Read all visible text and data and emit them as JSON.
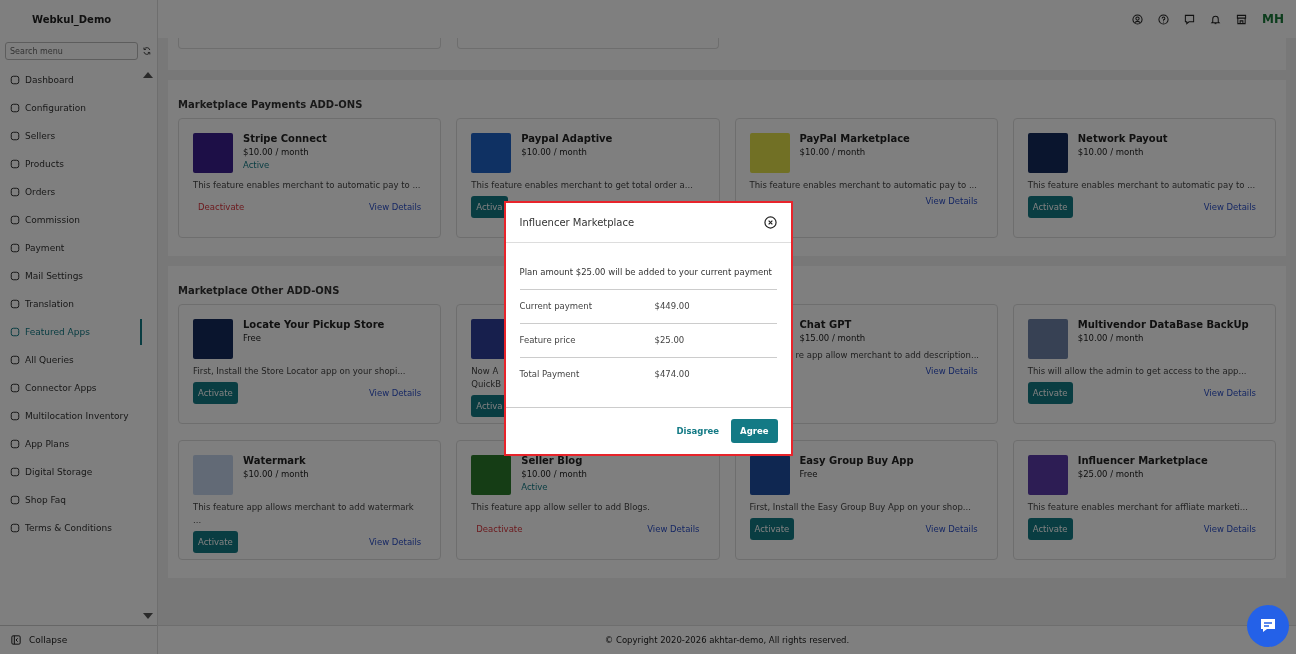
{
  "sidebar": {
    "brand": "Webkul_Demo",
    "search": {
      "placeholder": "Search menu"
    },
    "items": [
      {
        "label": "Dashboard",
        "selected": false
      },
      {
        "label": "Configuration",
        "selected": false
      },
      {
        "label": "Sellers",
        "selected": false
      },
      {
        "label": "Products",
        "selected": false
      },
      {
        "label": "Orders",
        "selected": false
      },
      {
        "label": "Commission",
        "selected": false
      },
      {
        "label": "Payment",
        "selected": false
      },
      {
        "label": "Mail Settings",
        "selected": false
      },
      {
        "label": "Translation",
        "selected": false
      },
      {
        "label": "Featured Apps",
        "selected": true
      },
      {
        "label": "All Queries",
        "selected": false
      },
      {
        "label": "Connector Apps",
        "selected": false
      },
      {
        "label": "Multilocation Inventory",
        "selected": false
      },
      {
        "label": "App Plans",
        "selected": false
      },
      {
        "label": "Digital Storage",
        "selected": false
      },
      {
        "label": "Shop Faq",
        "selected": false
      },
      {
        "label": "Terms & Conditions",
        "selected": false
      }
    ],
    "collapse": "Collapse"
  },
  "topbar": {
    "avatar": "MH"
  },
  "sections": [
    {
      "title": "Marketplace Payments ADD-ONS",
      "cards": [
        {
          "name": "Stripe Connect",
          "price": "$10.00 / month",
          "status": "Active",
          "description": "This feature enables merchant to automatic pay to ...",
          "action": {
            "label": "Deactivate",
            "kind": "deactivate"
          },
          "link": "View Details"
        },
        {
          "name": "Paypal Adaptive",
          "price": "$10.00 / month",
          "description": "This feature enables merchant to get total order a...",
          "action": {
            "label": "Activa",
            "kind": "activate"
          }
        },
        {
          "name": "PayPal Marketplace",
          "price": "$10.00 / month",
          "description": "This feature enables merchant to automatic pay to ...",
          "link": "View Details"
        },
        {
          "name": "Network Payout",
          "price": "$10.00 / month",
          "description": "This feature enables merchant to automatic pay to ...",
          "action": {
            "label": "Activate",
            "kind": "activate"
          },
          "link": "View Details"
        }
      ]
    },
    {
      "title": "Marketplace Other ADD-ONS",
      "cards": [
        {
          "name": "Locate Your Pickup Store",
          "price": "Free",
          "description": "First, Install the Store Locator app on your shopi...",
          "action": {
            "label": "Activate",
            "kind": "activate"
          },
          "link": "View Details"
        },
        {
          "description": "Now A\nQuickB",
          "action": {
            "label": "Activa",
            "kind": "activate"
          }
        },
        {
          "icon": false,
          "name": "Chat GPT",
          "price": "$15.00 / month",
          "description": "re app allow merchant to add description...",
          "link": "View Details"
        },
        {
          "name": "Multivendor DataBase BackUp",
          "price": "$10.00 / month",
          "description": "This will allow the admin to get access to the app...",
          "action": {
            "label": "Activate",
            "kind": "activate"
          },
          "link": "View Details"
        },
        {
          "name": "Watermark",
          "price": "$10.00 / month",
          "description": "This feature app allows merchant to add watermark\n...",
          "action": {
            "label": "Activate",
            "kind": "activate"
          },
          "link": "View Details"
        },
        {
          "name": "Seller Blog",
          "price": "$10.00 / month",
          "status": "Active",
          "description": "This feature app allow seller to add Blogs.",
          "action": {
            "label": "Deactivate",
            "kind": "deactivate"
          },
          "link": "View Details"
        },
        {
          "name": "Easy Group Buy App",
          "price": "Free",
          "description": "First, Install the Easy Group Buy App on your shop...",
          "action": {
            "label": "Activate",
            "kind": "activate"
          },
          "link": "View Details"
        },
        {
          "name": "Influencer Marketplace",
          "price": "$25.00 / month",
          "description": "This feature enables merchant for affliate marketi...",
          "action": {
            "label": "Activate",
            "kind": "activate"
          },
          "link": "View Details"
        }
      ]
    }
  ],
  "footer": "© Copyright 2020-2026 akhtar-demo, All rights reserved.",
  "modal": {
    "title": "Influencer Marketplace",
    "message": "Plan amount $25.00 will be added to your current payment",
    "rows": [
      {
        "label": "Current payment",
        "value": "$449.00"
      },
      {
        "label": "Feature price",
        "value": "$25.00"
      },
      {
        "label": "Total Payment",
        "value": "$474.00"
      }
    ],
    "buttons": [
      {
        "label": "Disagree",
        "kind": "link"
      },
      {
        "label": "Agree",
        "kind": "primary"
      }
    ]
  }
}
